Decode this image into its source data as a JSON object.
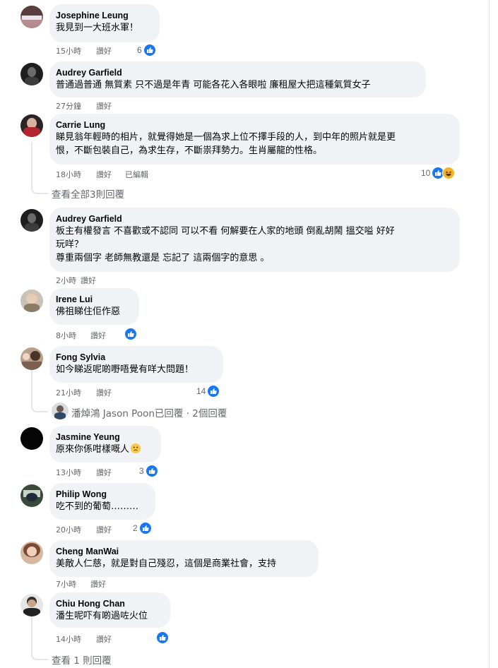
{
  "comments": [
    {
      "name": "Josephine Leung",
      "text": [
        "我見到一大班水軍！"
      ],
      "time": "15小時",
      "like": "讚好",
      "reactions": "6"
    },
    {
      "name": "Audrey Garfield",
      "text": [
        "普通過普通 無質素 只不過是年青 可能各花入各眼啦 廉租屋大把這種氣質女子"
      ],
      "time": "27分鐘",
      "like": "讚好"
    },
    {
      "name": "Carrie Lung",
      "text": [
        "睇見翁年輕時的相片，就覺得她是一個為求上位不擇手段的人，到中年的照片就是更",
        "恨，不斷包裝自己，為求生存，不斷祟拜勢力。生肖屬龍的性格。"
      ],
      "time": "18小時",
      "like": "讚好",
      "edited": "已編輯",
      "reactions": "10"
    },
    {
      "name": "Audrey Garfield",
      "text": [
        "板主有權發言 不喜歡或不認同 可以不看 何解要在人家的地頭 倒亂胡鬧 搵交嗌 好好",
        "玩咩？",
        "尊重兩個字 老師無教還是 忘記了 這兩個字的意思 。"
      ],
      "time": "2小時",
      "like": "讚好"
    },
    {
      "name": "Irene Lui",
      "text": [
        "佛祖睇住佢作惡"
      ],
      "time": "8小時",
      "like": "讚好",
      "reactions": ""
    },
    {
      "name": "Fong Sylvia",
      "text": [
        "如今睇返呢啲嘢唔覺有咩大問題！"
      ],
      "time": "21小時",
      "like": "讚好",
      "reactions": "14"
    },
    {
      "name": "Jasmine Yeung",
      "text": [
        "原來你係咁樣嘅人"
      ],
      "time": "13小時",
      "like": "讚好",
      "reactions": "3"
    },
    {
      "name": "Philip Wong",
      "text": [
        "吃不到的葡萄………"
      ],
      "time": "20小時",
      "like": "讚好",
      "reactions": "2"
    },
    {
      "name": "Cheng ManWai",
      "text": [
        "美敵人仁慈，就是對自己殘忍，這個是商業社會，支持"
      ],
      "time": "7小時",
      "like": "讚好"
    },
    {
      "name": "Chiu Hong Chan",
      "text": [
        "潘生呢吓有啲過咗火位"
      ],
      "time": "14小時",
      "like": "讚好",
      "reactions": ""
    }
  ],
  "replies": {
    "carrie": "查看全部3則回覆",
    "fong": "潘焯鴻 Jason Poon已回覆 · 2個回覆",
    "chiu": "查看 1 則回覆"
  },
  "colors": {
    "bubble": "#f0f2f5",
    "meta": "#65676b",
    "like_blue": "#1877f2",
    "haha_yellow": "#f7b125"
  }
}
